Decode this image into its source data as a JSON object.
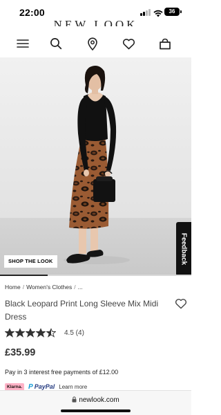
{
  "status_bar": {
    "time": "22:00",
    "battery": "36"
  },
  "brand": {
    "logo_text": "NEW LOOK"
  },
  "nav": {
    "icons": [
      "menu-icon",
      "search-icon",
      "store-locator-icon",
      "wishlist-icon",
      "bag-icon"
    ]
  },
  "hero": {
    "shop_the_look_label": "SHOP THE LOOK",
    "feedback_label": "Feedback",
    "gallery_progress": 0.25
  },
  "product": {
    "breadcrumb": [
      "Home",
      "Women's Clothes",
      "..."
    ],
    "title": "Black Leopard Print Long Sleeve Mix Midi Dress",
    "rating": 4.5,
    "rating_text": "4.5 (4)",
    "price": "£35.99",
    "klarna_text": "Pay in 3 interest free payments of £12.00",
    "klarna_badge": "Klarna.",
    "paypal_label": "PayPal",
    "learn_more_label": "Learn more"
  },
  "browser": {
    "url": "newlook.com"
  },
  "colors": {
    "klarna_pink": "#ffb3c7",
    "paypal_blue": "#253b80",
    "text_dark": "#222222"
  }
}
